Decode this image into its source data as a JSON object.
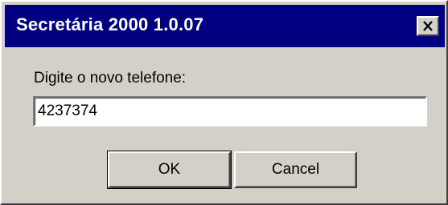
{
  "window": {
    "title": "Secretária 2000 1.0.07",
    "close_icon": "close-icon"
  },
  "prompt": {
    "label": "Digite o novo telefone:"
  },
  "phone_input": {
    "value": "4237374"
  },
  "buttons": {
    "ok_label": "OK",
    "cancel_label": "Cancel"
  },
  "colors": {
    "titlebar": "#000080",
    "dialog_face": "#d4d0c8",
    "title_text": "#ffffff"
  }
}
